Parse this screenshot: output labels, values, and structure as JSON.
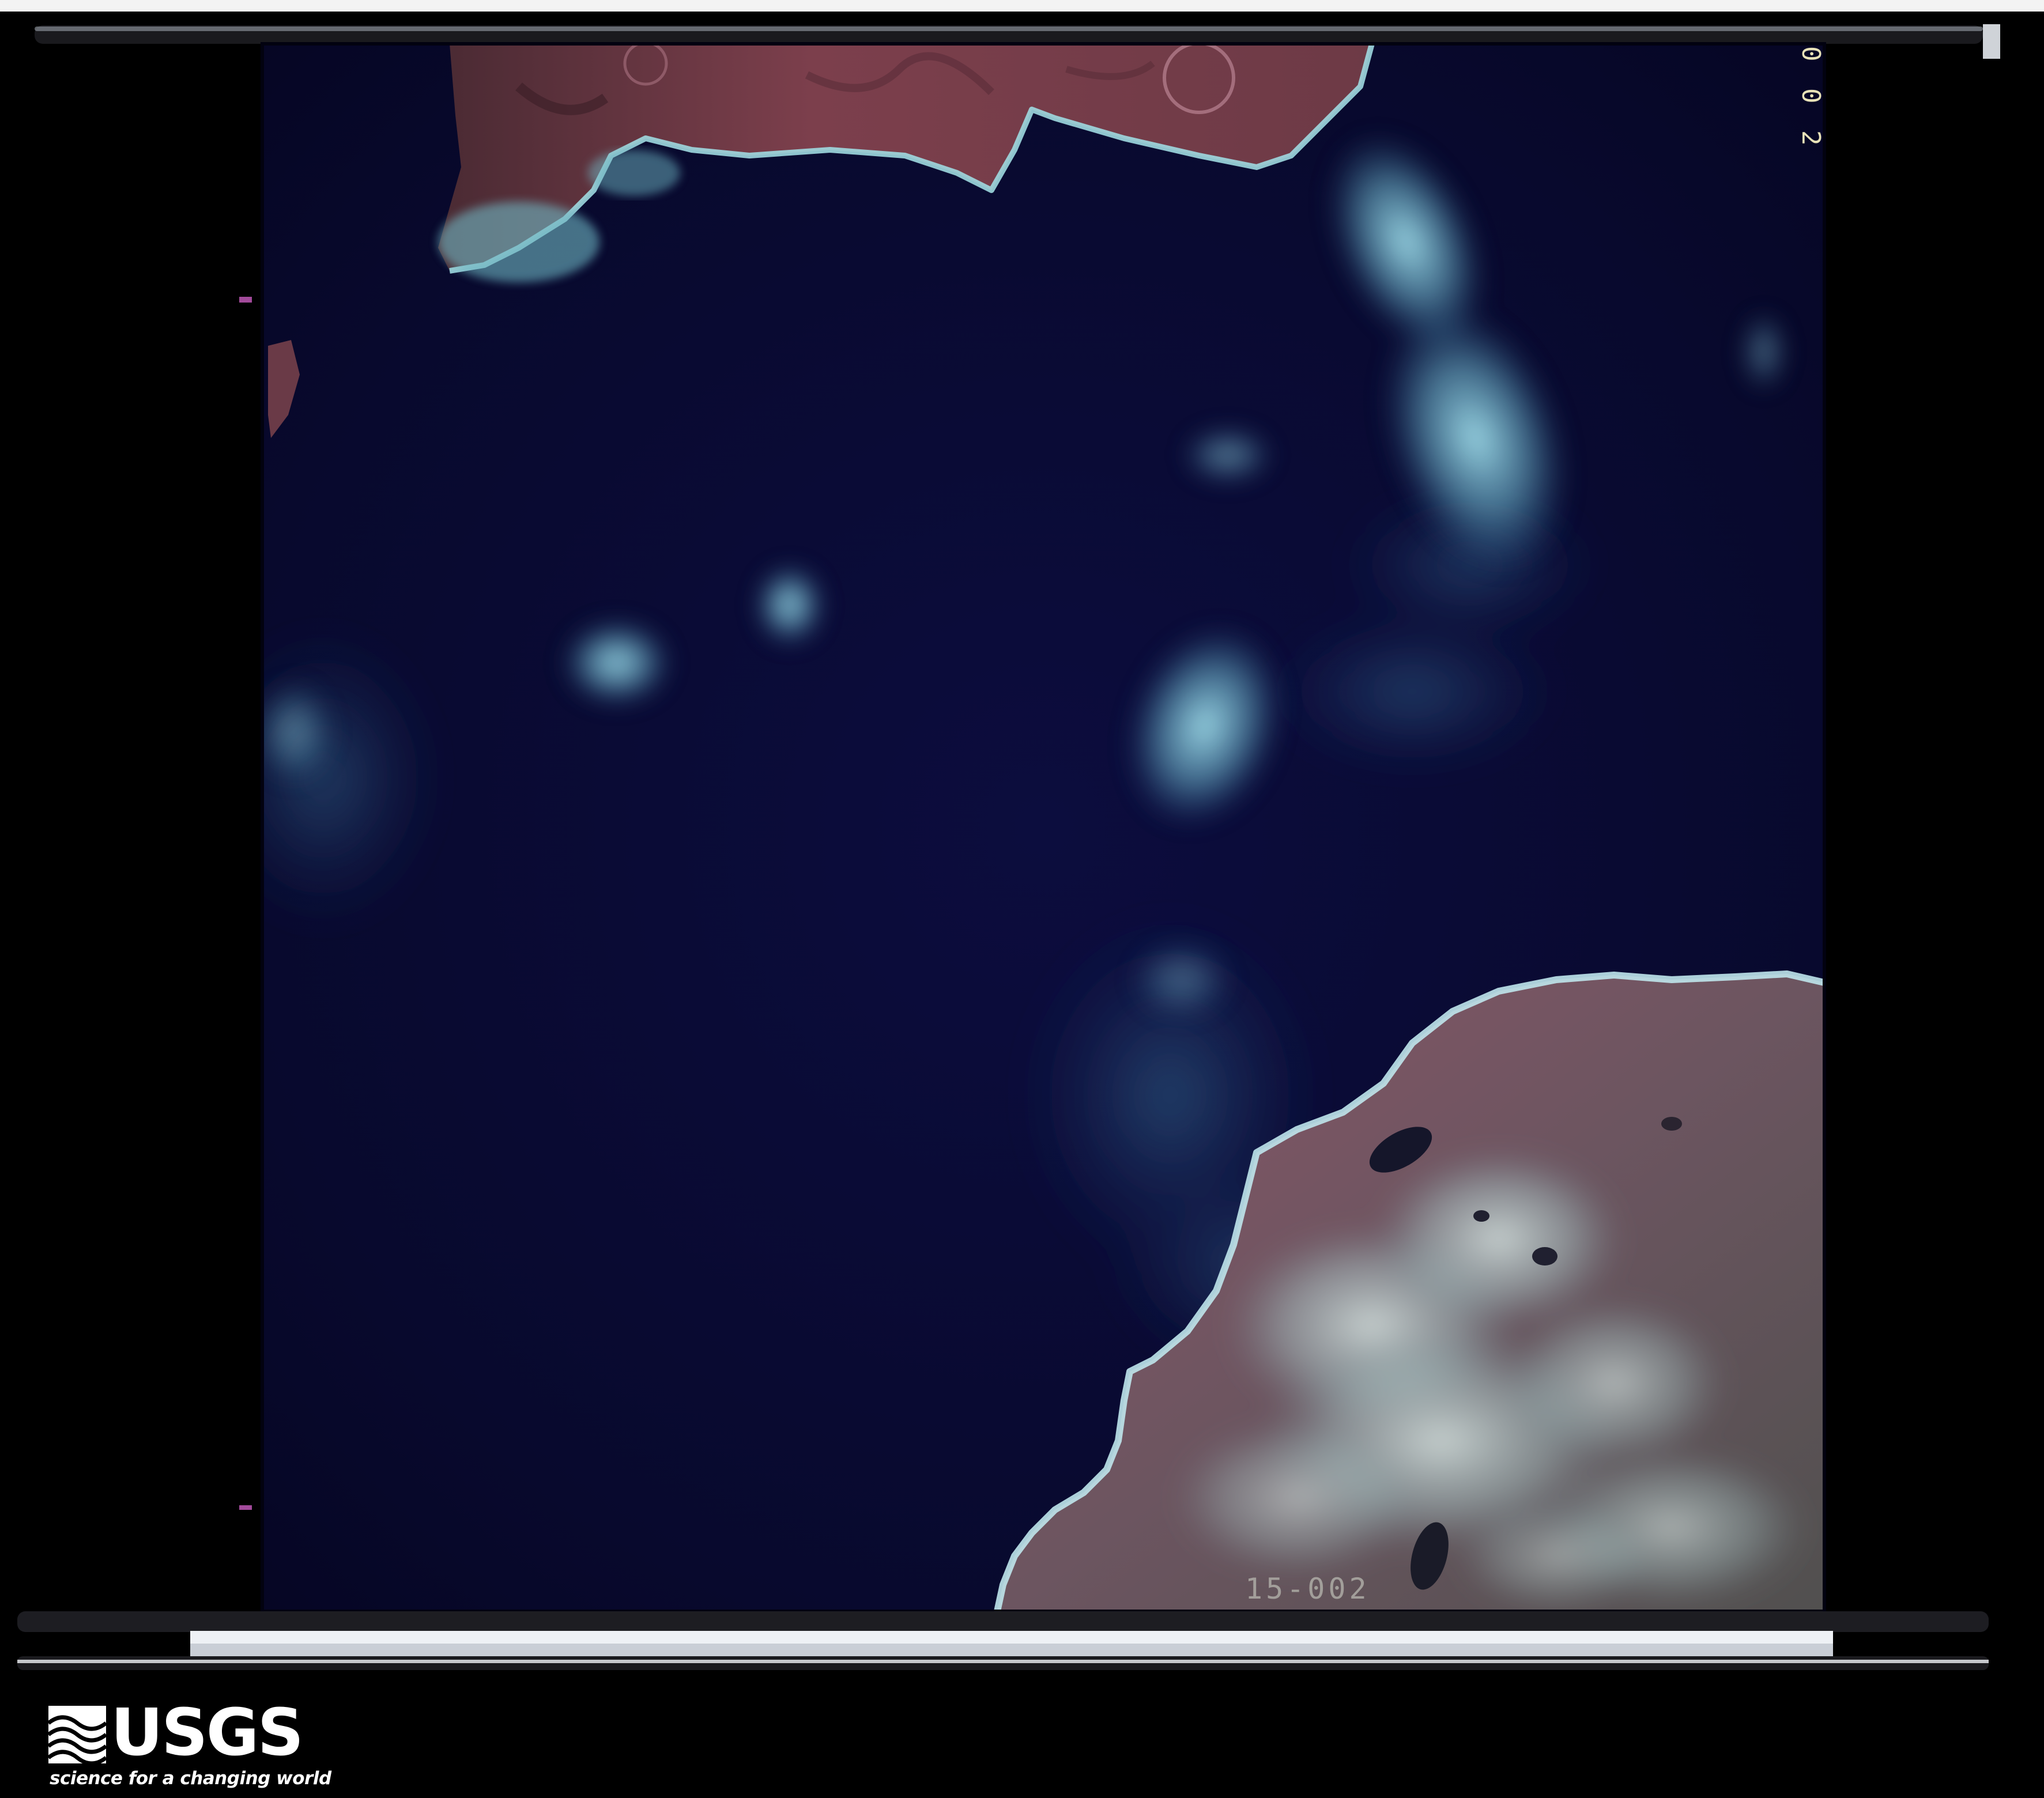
{
  "frame": {
    "number": "0 0 2",
    "code": "15-002"
  },
  "logo": {
    "wordmark": "USGS",
    "tagline": "science for a changing world"
  },
  "colors": {
    "background": "#000000",
    "ocean": "#0a0b38",
    "land": "#7a4f5e",
    "cloud": "#8fd3e3",
    "film_strip": "#f3f3f3"
  }
}
